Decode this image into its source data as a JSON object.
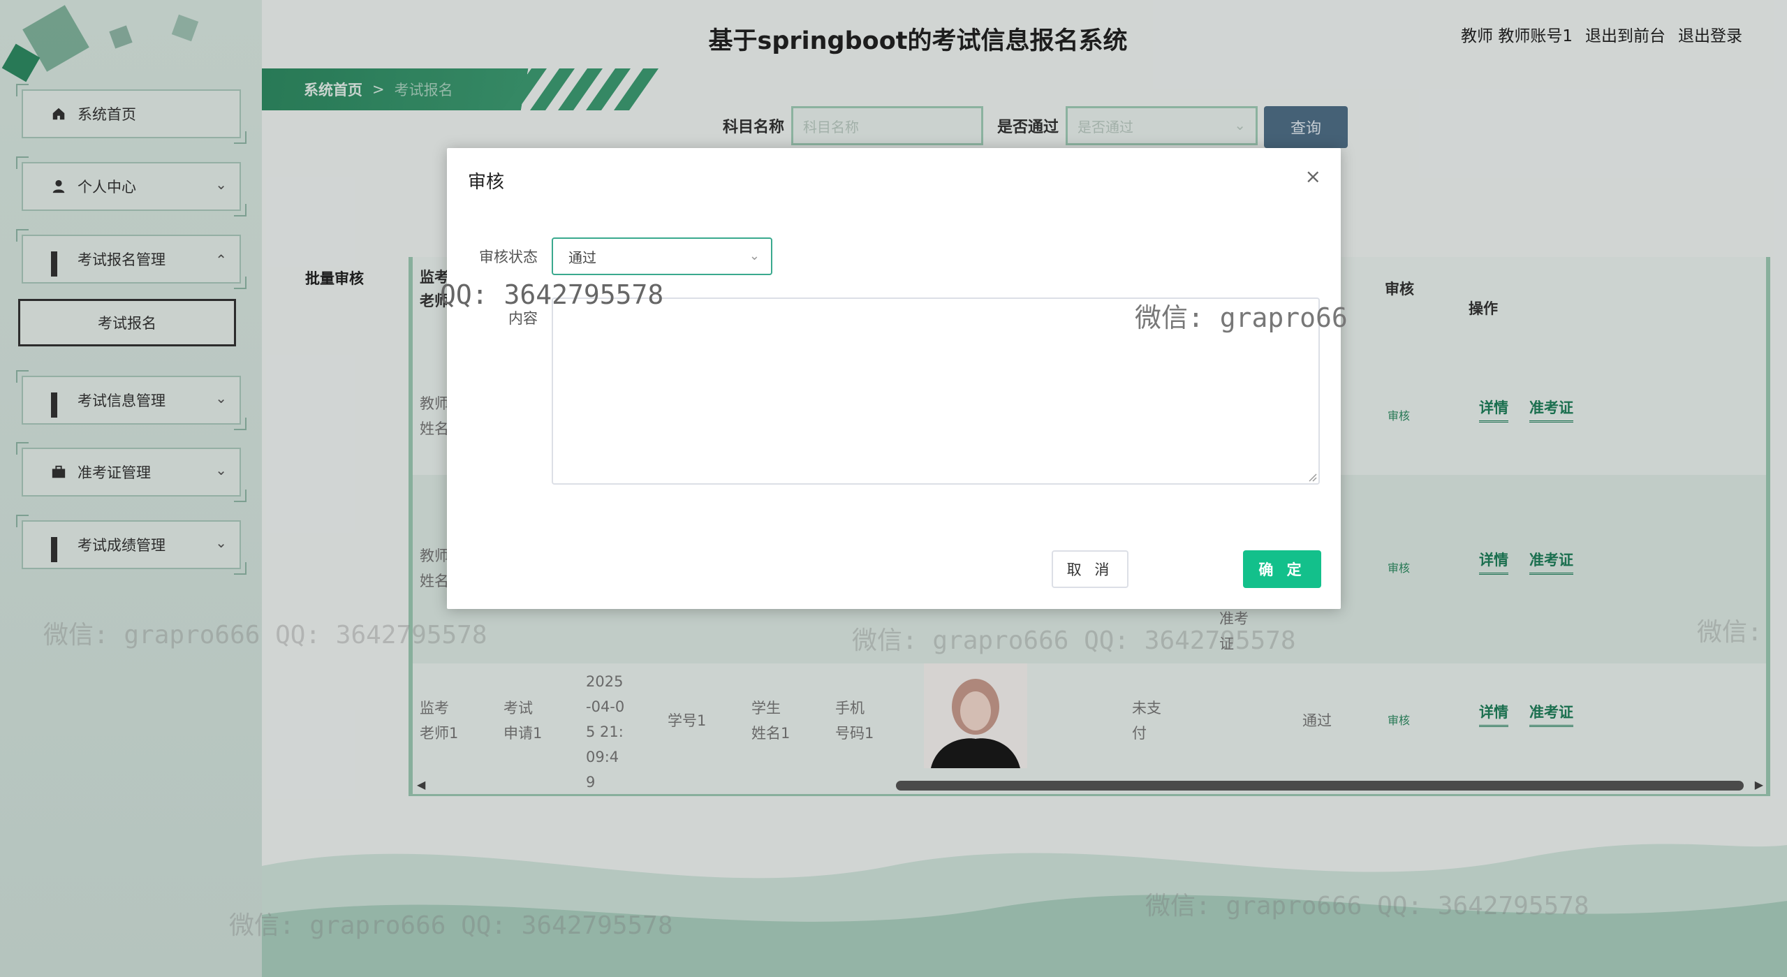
{
  "header": {
    "title": "基于springboot的考试信息报名系统",
    "user_role": "教师",
    "user_name": "教师账号1",
    "back_front": "退出到前台",
    "logout": "退出登录"
  },
  "breadcrumb": {
    "home": "系统首页",
    "sep": ">",
    "current": "考试报名"
  },
  "sidebar": {
    "items": [
      {
        "label": "系统首页",
        "icon": "home-icon"
      },
      {
        "label": "个人中心",
        "icon": "user-icon"
      },
      {
        "label": "考试报名管理",
        "icon": "grid-icon"
      },
      {
        "label": "考试报名",
        "icon": ""
      },
      {
        "label": "考试信息管理",
        "icon": "grid-icon"
      },
      {
        "label": "准考证管理",
        "icon": "briefcase-icon"
      },
      {
        "label": "考试成绩管理",
        "icon": "grid-icon"
      }
    ]
  },
  "search": {
    "subject_label": "科目名称",
    "subject_placeholder": "科目名称",
    "pass_label": "是否通过",
    "pass_placeholder": "是否通过",
    "query_button": "查询"
  },
  "table": {
    "batch_label": "批量审核",
    "headers": {
      "teacher": "监考老师",
      "audit": "审核",
      "ops": "操作"
    },
    "rows": [
      {
        "teacher": "教师姓名",
        "audit": "审核",
        "detail": "详情",
        "ticket": "准考证"
      },
      {
        "teacher": "教师姓名",
        "extra": "准考证",
        "audit": "审核",
        "detail": "详情",
        "ticket": "准考证"
      },
      {
        "teacher": "监考老师1",
        "apply": "考试申请1",
        "time": "2025-04-05 21:09:49",
        "student_no": "学号1",
        "student_name": "学生姓名1",
        "phone": "手机号码1",
        "pay": "未支付",
        "pass": "通过",
        "audit": "审核",
        "detail": "详情",
        "ticket": "准考证"
      }
    ]
  },
  "modal": {
    "title": "审核",
    "status_label": "审核状态",
    "status_value": "通过",
    "content_label": "内容",
    "cancel": "取 消",
    "confirm": "确 定"
  },
  "watermarks": {
    "qq": "QQ: 3642795578",
    "wechat": "微信: grapro66",
    "full1": "微信: grapro666 QQ: 3642795578",
    "full2": "微信: grapro666 QQ: 3642795578",
    "full3": "微信: grapro666 QQ: 3642795578",
    "full4": "微信: grapro666 QQ: 3642795578",
    "full5": "微信:"
  },
  "colors": {
    "accent": "#13c08b",
    "brand_green": "#2e8a62",
    "query_btn": "#4f6f87"
  }
}
